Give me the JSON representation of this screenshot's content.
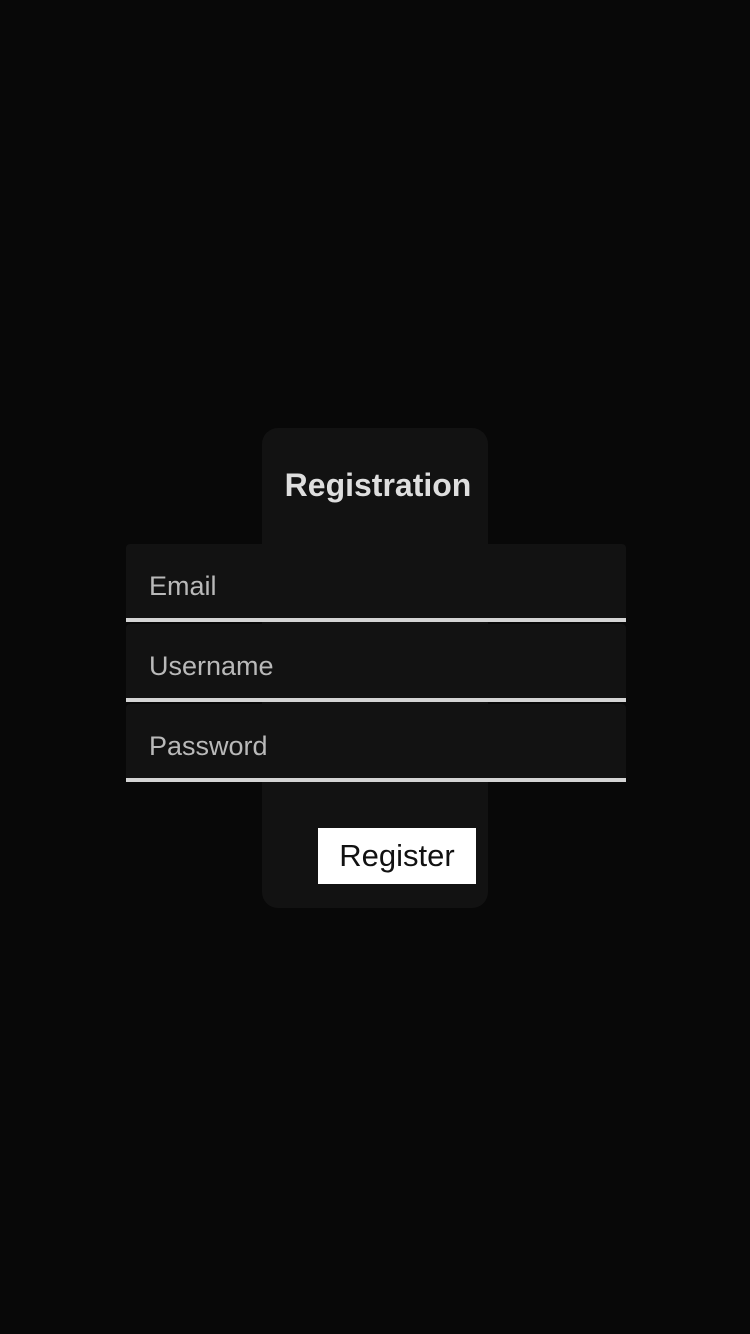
{
  "form": {
    "title": "Registration",
    "fields": {
      "email": {
        "placeholder": "Email",
        "value": ""
      },
      "username": {
        "placeholder": "Username",
        "value": ""
      },
      "password": {
        "placeholder": "Password",
        "value": ""
      }
    },
    "submit_label": "Register"
  },
  "colors": {
    "page_background": "#080808",
    "card_background": "#121212",
    "field_underline": "#d4d4d4",
    "title_text": "#dedede",
    "button_background": "#ffffff",
    "button_text": "#111111"
  }
}
